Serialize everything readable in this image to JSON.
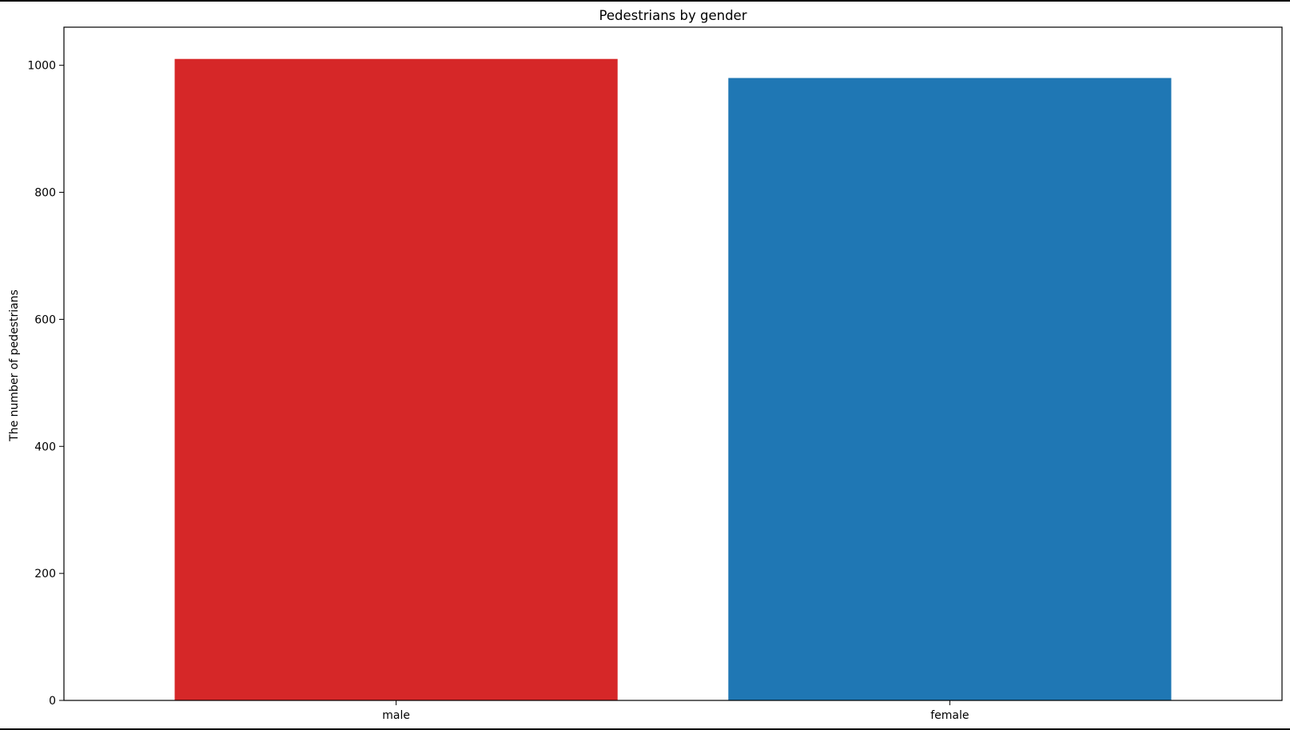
{
  "chart_data": {
    "type": "bar",
    "title": "Pedestrians by gender",
    "xlabel": "",
    "ylabel": "The number of pedestrians",
    "categories": [
      "male",
      "female"
    ],
    "values": [
      1010,
      980
    ],
    "colors": [
      "#d62728",
      "#1f77b4"
    ],
    "ylim": [
      0,
      1060
    ],
    "yticks": [
      0,
      200,
      400,
      600,
      800,
      1000
    ],
    "grid": false,
    "legend": "none"
  }
}
